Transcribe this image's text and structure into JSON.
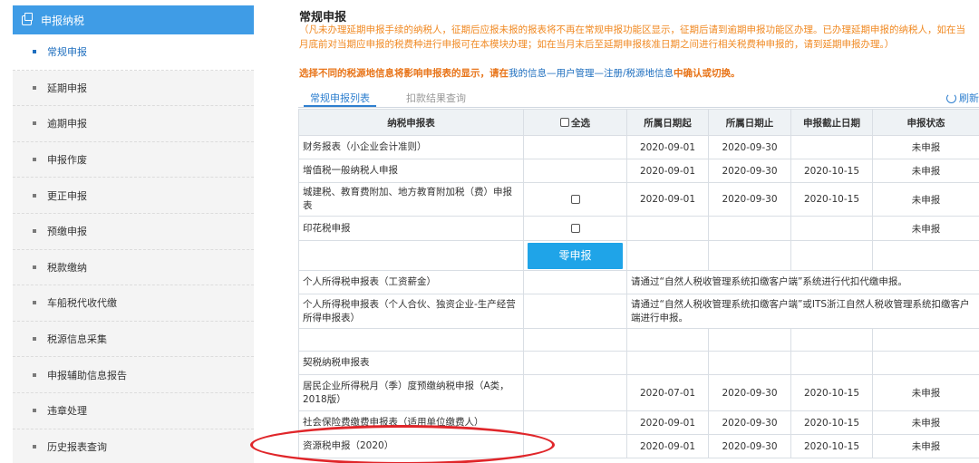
{
  "sidebar": {
    "header": "申报纳税",
    "items": [
      {
        "label": "常规申报",
        "active": true
      },
      {
        "label": "延期申报"
      },
      {
        "label": "逾期申报"
      },
      {
        "label": "申报作废"
      },
      {
        "label": "更正申报"
      },
      {
        "label": "预缴申报"
      },
      {
        "label": "税款缴纳"
      },
      {
        "label": "车船税代收代缴"
      },
      {
        "label": "税源信息采集"
      },
      {
        "label": "申报辅助信息报告"
      },
      {
        "label": "违章处理"
      },
      {
        "label": "历史报表查询"
      }
    ]
  },
  "main": {
    "title": "常规申报",
    "notice": "（凡未办理延期申报手续的纳税人，征期后应报未报的报表将不再在常规申报功能区显示，征期后请到逾期申报功能区办理。已办理延期申报的纳税人，如在当月底前对当期应申报的税费种进行申报可在本模块办理；如在当月末后至延期申报核准日期之间进行相关税费种申报的，请到延期申报办理。）",
    "warn_prefix": "选择不同的税源地信息将影响申报表的显示，请在",
    "warn_link": "我的信息—用户管理—注册/税源地信息",
    "warn_suffix": "中确认或切换。",
    "tabs": [
      "常规申报列表",
      "扣款结果查询"
    ],
    "refresh_label": "刷新"
  },
  "table": {
    "headers": [
      "纳税申报表",
      "全选",
      "所属日期起",
      "所属日期止",
      "申报截止日期",
      "申报状态"
    ],
    "rows": [
      {
        "name": "财务报表（小企业会计准则）",
        "start": "2020-09-01",
        "end": "2020-09-30",
        "deadline": "",
        "status": "未申报"
      },
      {
        "name": "增值税一般纳税人申报",
        "start": "2020-09-01",
        "end": "2020-09-30",
        "deadline": "2020-10-15",
        "status": "未申报"
      },
      {
        "name": "城建税、教育费附加、地方教育附加税（费）申报表",
        "start": "2020-09-01",
        "end": "2020-09-30",
        "deadline": "2020-10-15",
        "status": "未申报"
      },
      {
        "name": "印花税申报",
        "status": "未申报"
      },
      {
        "zero_button": "零申报"
      },
      {
        "name": "个人所得税申报表（工资薪金）",
        "span_text": "请通过“自然人税收管理系统扣缴客户端”系统进行代扣代缴申报。"
      },
      {
        "name": "个人所得税申报表（个人合伙、独资企业-生产经营所得申报表）",
        "span_text": "请通过“自然人税收管理系统扣缴客户端”或ITS浙江自然人税收管理系统扣缴客户端进行申报。"
      },
      {
        "name": ""
      },
      {
        "name": "契税纳税申报表"
      },
      {
        "name": "居民企业所得税月（季）度预缴纳税申报（A类，2018版）",
        "start": "2020-07-01",
        "end": "2020-09-30",
        "deadline": "2020-10-15",
        "status": "未申报"
      },
      {
        "name": "社会保险费缴费申报表（适用单位缴费人）",
        "start": "2020-09-01",
        "end": "2020-09-30",
        "deadline": "2020-10-15",
        "status": "未申报"
      },
      {
        "name": "资源税申报（2020）",
        "start": "2020-09-01",
        "end": "2020-09-30",
        "deadline": "2020-10-15",
        "status": "未申报"
      }
    ]
  },
  "colors": {
    "sidebar_header": "#3f9ce6",
    "accent": "#2e7fcf",
    "notice": "#f08a24",
    "zero_button": "#1fa4e8",
    "highlight_ellipse": "#e0262a"
  }
}
